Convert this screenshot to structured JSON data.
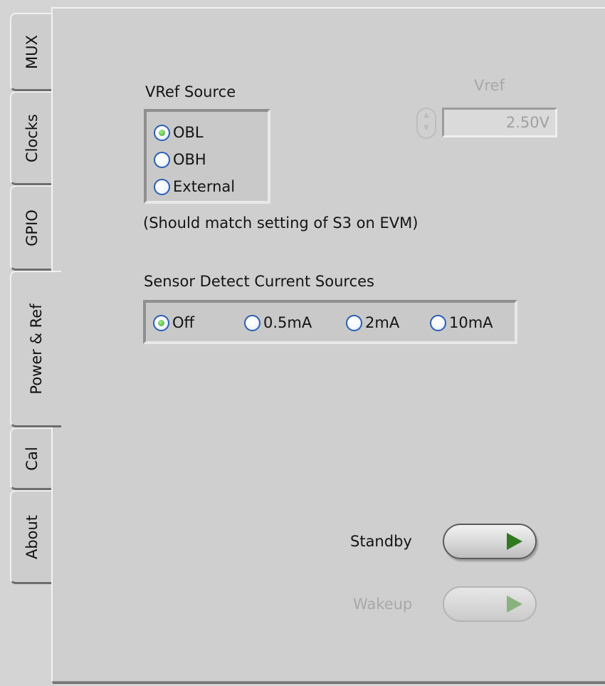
{
  "tabs": [
    {
      "label": "MUX",
      "active": false
    },
    {
      "label": "Clocks",
      "active": false
    },
    {
      "label": "GPIO",
      "active": false
    },
    {
      "label": "Power & Ref",
      "active": true
    },
    {
      "label": "Cal",
      "active": false
    },
    {
      "label": "About",
      "active": false
    }
  ],
  "vref_source": {
    "title": "VRef Source",
    "options": [
      "OBL",
      "OBH",
      "External"
    ],
    "selected": "OBL",
    "note": "(Should match setting of S3 on EVM)"
  },
  "vref": {
    "label": "Vref",
    "value": "2.50V",
    "enabled": false
  },
  "sensor_detect": {
    "title": "Sensor Detect Current Sources",
    "options": [
      "Off",
      "0.5mA",
      "2mA",
      "10mA"
    ],
    "selected": "Off"
  },
  "standby": {
    "label": "Standby",
    "enabled": true
  },
  "wakeup": {
    "label": "Wakeup",
    "enabled": false
  },
  "colors": {
    "panel": "#cfcfcf",
    "radio_border": "#2b5fb4",
    "radio_checked": "#3fa52a",
    "play_enabled": "#2f7a1e",
    "disabled_text": "#a8a8a8"
  }
}
